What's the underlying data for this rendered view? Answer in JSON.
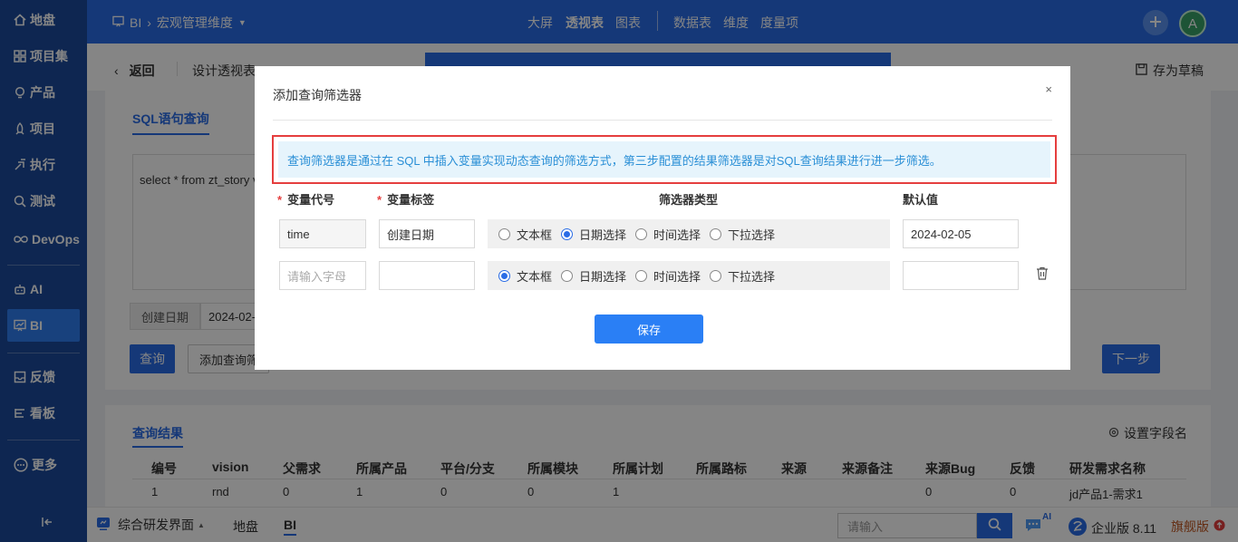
{
  "sidebar": {
    "items": [
      {
        "label": "地盘",
        "icon": "home-icon"
      },
      {
        "label": "项目集",
        "icon": "grid-icon"
      },
      {
        "label": "产品",
        "icon": "bulb-icon"
      },
      {
        "label": "项目",
        "icon": "rocket-icon"
      },
      {
        "label": "执行",
        "icon": "run-icon"
      },
      {
        "label": "测试",
        "icon": "search-check-icon"
      },
      {
        "label": "DevOps",
        "icon": "infinity-icon"
      },
      {
        "label": "AI",
        "icon": "robot-icon"
      },
      {
        "label": "BI",
        "icon": "chart-board-icon"
      },
      {
        "label": "反馈",
        "icon": "inbox-icon"
      },
      {
        "label": "看板",
        "icon": "kanban-icon"
      },
      {
        "label": "更多",
        "icon": "more-icon"
      }
    ]
  },
  "topbar": {
    "breadcrumb_root": "BI",
    "breadcrumb_current": "宏观管理维度",
    "nav": [
      "大屏",
      "透视表",
      "图表",
      "数据表",
      "维度",
      "度量项"
    ],
    "avatar": "A"
  },
  "subbar": {
    "back": "返回",
    "design": "设计透视表",
    "draft": "存为草稿"
  },
  "query": {
    "tab": "SQL语句查询",
    "sql": "select * from zt_story v",
    "filter_label": "创建日期",
    "filter_value": "2024-02-",
    "btn_query": "查询",
    "btn_add": "添加查询筛",
    "btn_next": "下一步"
  },
  "results": {
    "tab": "查询结果",
    "set_fields": "设置字段名",
    "columns": [
      "编号",
      "vision",
      "父需求",
      "所属产品",
      "平台/分支",
      "所属模块",
      "所属计划",
      "所属路标",
      "来源",
      "来源备注",
      "来源Bug",
      "反馈",
      "研发需求名称"
    ],
    "rows": [
      [
        "1",
        "rnd",
        "0",
        "1",
        "0",
        "0",
        "1",
        "",
        "",
        "",
        "0",
        "0",
        "jd产品1-需求1"
      ]
    ]
  },
  "bottombar": {
    "app": "综合研发界面",
    "tabs": [
      "地盘",
      "BI"
    ],
    "search_placeholder": "请输入",
    "ai_badge": "AI",
    "version": "企业版 8.11",
    "flagship": "旗舰版"
  },
  "modal": {
    "title": "添加查询筛选器",
    "close": "×",
    "notice": "查询筛选器是通过在 SQL 中插入变量实现动态查询的筛选方式，第三步配置的结果筛选器是对SQL查询结果进行进一步筛选。",
    "headers": {
      "code": "变量代号",
      "label": "变量标签",
      "type": "筛选器类型",
      "default": "默认值"
    },
    "required_mark": "*",
    "type_options": [
      "文本框",
      "日期选择",
      "时间选择",
      "下拉选择"
    ],
    "rows": [
      {
        "code": "time",
        "label": "创建日期",
        "selected": "日期选择",
        "default": "2024-02-05"
      },
      {
        "code_placeholder": "请输入字母",
        "label": "",
        "selected": "文本框",
        "default": ""
      }
    ],
    "save": "保存"
  },
  "colors": {
    "primary": "#2a6ce6",
    "sidebar": "#1b4a9c",
    "notice_bg": "#e6f4fc",
    "notice_border": "#e53e3e"
  }
}
